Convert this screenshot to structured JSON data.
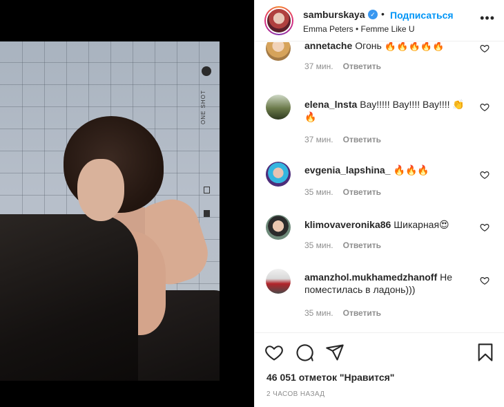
{
  "post": {
    "username": "samburskaya",
    "follow_label": "Подписаться",
    "separator": "•",
    "audio": "Emma Peters • Femme Like U",
    "more_icon": "more-horizontal-icon",
    "photo_side_text": "ONE SHOT"
  },
  "comments": [
    {
      "user": "annetache",
      "text": "Огонь 🔥🔥🔥🔥🔥",
      "time": "37 мин.",
      "reply": "Ответить"
    },
    {
      "user": "elena_lnsta",
      "text": "Вау!!!!! Вау!!!! Вау!!!! 👏🔥",
      "time": "37 мин.",
      "reply": "Ответить"
    },
    {
      "user": "evgenia_lapshina_",
      "text": "🔥🔥🔥",
      "time": "35 мин.",
      "reply": "Ответить"
    },
    {
      "user": "klimovaveronika86",
      "text": "Шикарная😍",
      "time": "35 мин.",
      "reply": "Ответить"
    },
    {
      "user": "amanzhol.mukhamedzhanoff",
      "text": "Не поместилась в ладонь)))",
      "time": "35 мин.",
      "reply": "Ответить"
    }
  ],
  "actions": {
    "likes": "46 051 отметок \"Нравится\"",
    "time_ago": "2 ЧАСОВ НАЗАД"
  },
  "colors": {
    "accent": "#0095f6",
    "text": "#262626",
    "muted": "#8e8e8e",
    "border": "#efefef"
  }
}
